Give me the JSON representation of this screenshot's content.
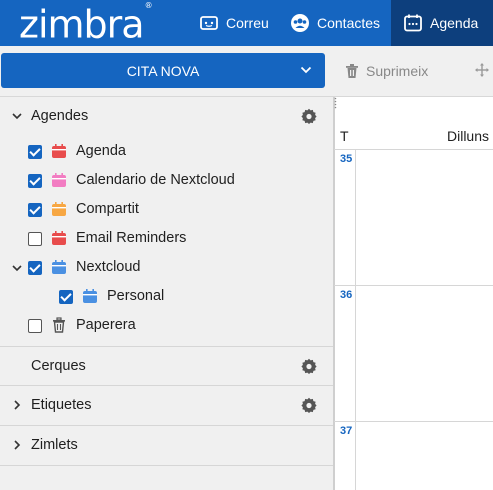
{
  "header": {
    "logo": "zimbra",
    "logo_mark": "®",
    "nav": [
      {
        "label": "Correu",
        "icon": "mail-icon"
      },
      {
        "label": "Contactes",
        "icon": "contacts-icon"
      },
      {
        "label": "Agenda",
        "icon": "calendar-icon",
        "active": true
      }
    ]
  },
  "toolbar": {
    "new_label": "CITA NOVA",
    "delete_label": "Suprimeix"
  },
  "sidebar": {
    "calendars_header": "Agendes",
    "calendars": [
      {
        "label": "Agenda",
        "checked": true,
        "color": "#e84c4c"
      },
      {
        "label": "Calendario de Nextcloud",
        "checked": true,
        "color": "#f27cc2"
      },
      {
        "label": "Compartit",
        "checked": true,
        "color": "#f7a743"
      },
      {
        "label": "Email Reminders",
        "checked": false,
        "color": "#e84c4c"
      },
      {
        "label": "Nextcloud",
        "checked": true,
        "color": "#4a90e2"
      },
      {
        "label": "Personal",
        "checked": true,
        "color": "#4a90e2"
      },
      {
        "label": "Paperera",
        "checked": false,
        "color": "#666666"
      }
    ],
    "searches_header": "Cerques",
    "tags_header": "Etiquetes",
    "zimlets_header": "Zimlets"
  },
  "calendar": {
    "week_col_label": "T",
    "day_label": "Dilluns",
    "weeks": [
      "35",
      "36",
      "37"
    ]
  },
  "colors": {
    "brand": "#1565c0",
    "brand_dark": "#0d3f7d"
  }
}
